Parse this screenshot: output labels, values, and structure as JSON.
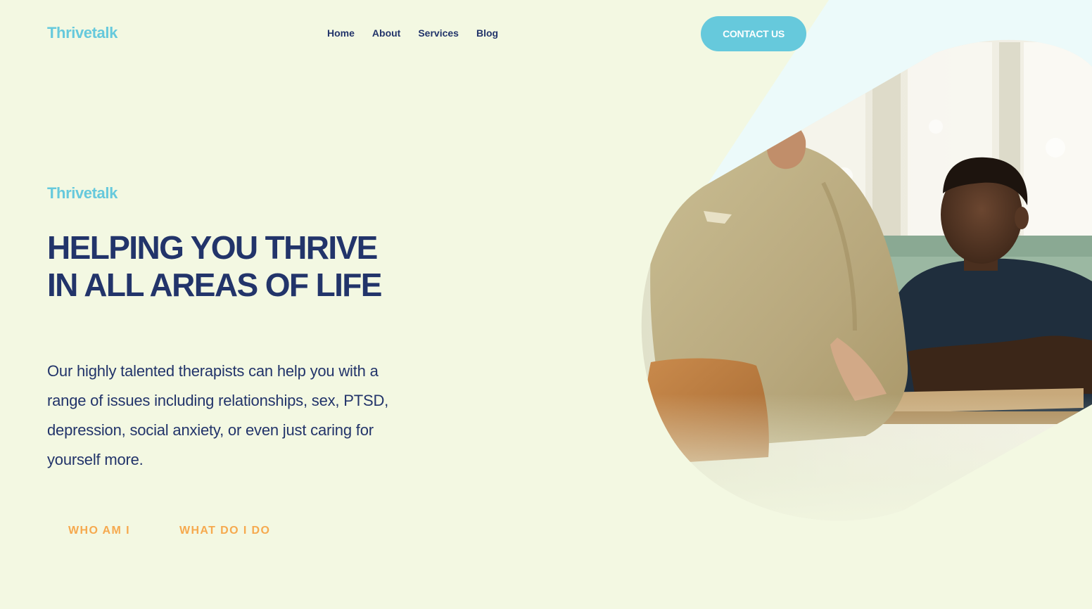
{
  "header": {
    "logo": "Thrivetalk",
    "nav": [
      {
        "label": "Home"
      },
      {
        "label": "About"
      },
      {
        "label": "Services"
      },
      {
        "label": "Blog"
      }
    ],
    "contact_label": "CONTACT US"
  },
  "hero": {
    "brand": "Thrivetalk",
    "title_line1": "HELPING YOU THRIVE",
    "title_line2": "IN ALL AREAS OF LIFE",
    "description": "Our highly talented therapists can help you with a range of issues including relationships, sex, PTSD, depression, social anxiety, or even just caring for yourself more.",
    "cta_primary": "WHO AM I",
    "cta_secondary": "WHAT DO I DO",
    "image_icon": "therapy-session-photo"
  },
  "colors": {
    "background": "#f3f8e2",
    "accent": "#66c9dc",
    "navy": "#22346a",
    "orange": "#f6a94e",
    "light_blue": "#ecfafa"
  }
}
